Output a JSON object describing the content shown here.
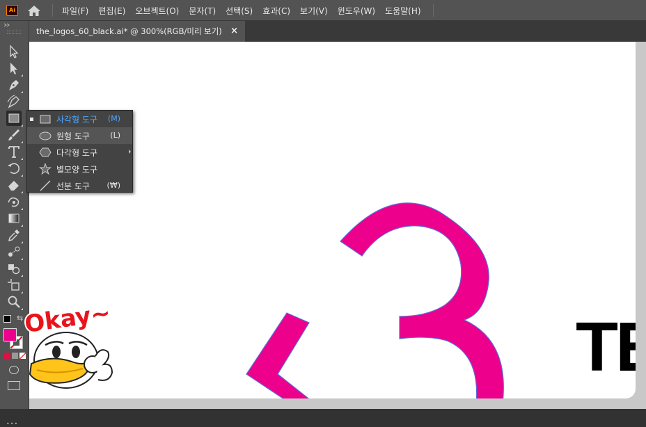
{
  "app": {
    "logo_text": "Ai"
  },
  "menu": [
    "파일(F)",
    "편집(E)",
    "오브젝트(O)",
    "문자(T)",
    "선택(S)",
    "효과(C)",
    "보기(V)",
    "윈도우(W)",
    "도움말(H)"
  ],
  "document_tab": {
    "title": "the_logos_60_black.ai*  @  300%(RGB/미리 보기)",
    "close": "×"
  },
  "flyout": {
    "items": [
      {
        "icon": "rectangle-icon",
        "label": "사각형 도구",
        "shortcut": "(M)",
        "active": true
      },
      {
        "icon": "ellipse-icon",
        "label": "원형 도구",
        "shortcut": "(L)"
      },
      {
        "icon": "polygon-icon",
        "label": "다각형 도구",
        "shortcut": ""
      },
      {
        "icon": "star-icon",
        "label": "별모양 도구",
        "shortcut": ""
      },
      {
        "icon": "line-segment-icon",
        "label": "선분 도구",
        "shortcut": "(₩)"
      }
    ]
  },
  "tools": [
    "selection-tool-icon",
    "direct-selection-tool-icon",
    "pen-tool-icon",
    "curvature-tool-icon",
    "rectangle-tool-icon",
    "paintbrush-tool-icon",
    "type-tool-icon",
    "rotate-tool-icon",
    "eraser-tool-icon",
    "warp-tool-icon",
    "gradient-tool-icon",
    "eyedropper-tool-icon",
    "blend-tool-icon",
    "shape-builder-tool-icon",
    "artboard-tool-icon",
    "zoom-tool-icon"
  ],
  "artwork": {
    "digit": "3",
    "fill": "#ec008c",
    "stroke": "#5b6cd8",
    "letters": "TE",
    "letters_color": "#000000"
  },
  "colors": {
    "fill_swatch": "#ec008c",
    "stroke_swatch": "#ffffff",
    "accent_blue": "#4ea8ff"
  },
  "sticker": {
    "text": "Okay~"
  }
}
